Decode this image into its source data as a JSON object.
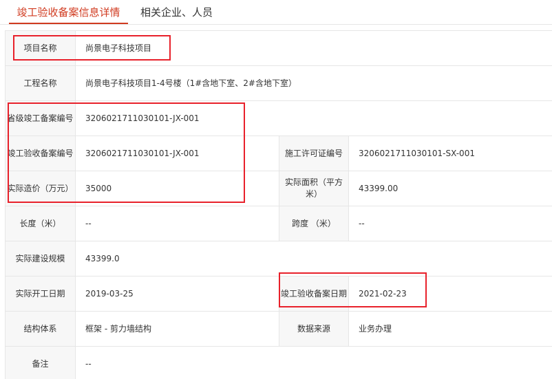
{
  "tabs": [
    {
      "label": "竣工验收备案信息详情"
    },
    {
      "label": "相关企业、人员"
    }
  ],
  "fields": {
    "project_name": {
      "label": "项目名称",
      "value": "尚景电子科技项目"
    },
    "engineering_name": {
      "label": "工程名称",
      "value": "尚景电子科技项目1-4号楼（1#含地下室、2#含地下室）"
    },
    "provincial_record_no": {
      "label": "省级竣工备案编号",
      "value": "3206021711030101-JX-001"
    },
    "completion_record_no": {
      "label": "竣工验收备案编号",
      "value": "3206021711030101-JX-001"
    },
    "construction_permit_no": {
      "label": "施工许可证编号",
      "value": "3206021711030101-SX-001"
    },
    "actual_cost": {
      "label": "实际造价（万元）",
      "value": "35000"
    },
    "actual_area": {
      "label": "实际面积（平方米）",
      "value": "43399.00"
    },
    "length": {
      "label": "长度（米）",
      "value": "--"
    },
    "span": {
      "label": "跨度 （米）",
      "value": "--"
    },
    "actual_scale": {
      "label": "实际建设规模",
      "value": "43399.0"
    },
    "actual_start_date": {
      "label": "实际开工日期",
      "value": "2019-03-25"
    },
    "record_date": {
      "label": "竣工验收备案日期",
      "value": "2021-02-23"
    },
    "structure_system": {
      "label": "结构体系",
      "value": "框架 - 剪力墙结构"
    },
    "data_source": {
      "label": "数据来源",
      "value": "业务办理"
    },
    "remarks": {
      "label": "备注",
      "value": "--"
    }
  },
  "colors": {
    "accent": "#d03a1f",
    "highlight": "#e8202a",
    "label_bg": "#f7f7f7",
    "border": "#e6e6e6"
  }
}
